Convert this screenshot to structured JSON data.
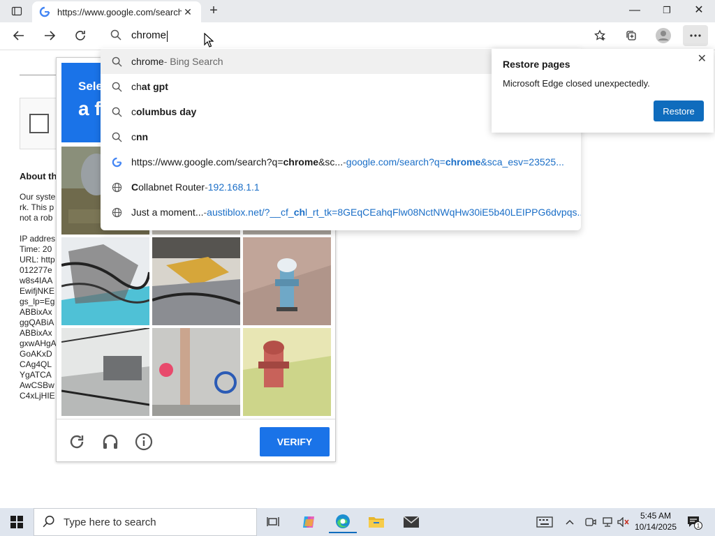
{
  "browser": {
    "tab": {
      "title": "https://www.google.com/search?"
    },
    "window_controls": {
      "minimize": "—",
      "maximize": "❐",
      "close": "✕"
    }
  },
  "omnibox": {
    "value": "chrome"
  },
  "suggestions": [
    {
      "icon": "search-icon",
      "bold": "",
      "rest": "chrome",
      "tail": " - Bing Search"
    },
    {
      "icon": "search-icon",
      "pre": "ch",
      "bold": "at gpt"
    },
    {
      "icon": "search-icon",
      "pre": "c",
      "bold": "olumbus day"
    },
    {
      "icon": "search-icon",
      "pre": "c",
      "bold": "nn"
    },
    {
      "icon": "google-icon",
      "url_pre": "https://www.google.com/search?q=",
      "url_bold": "chrome",
      "url_post": "&sc...",
      "link_pre": "google.com/search?q=",
      "link_bold": "chrome",
      "link_post": "&sca_esv=23525..."
    },
    {
      "icon": "globe-icon",
      "pre_bold": "C",
      "text": "ollabnet Router",
      "link": "192.168.1.1"
    },
    {
      "icon": "globe-icon",
      "text": "Just a moment...",
      "link_pre": "austiblox.net/?__cf_",
      "link_bold": "ch",
      "link_post": "l_rt_tk=8GEqCEahqFlw08NctNWqHw30iE5b40LEIPPG6dvpqs..."
    }
  ],
  "separator": " - ",
  "restore_popup": {
    "title": "Restore pages",
    "message": "Microsoft Edge closed unexpectedly.",
    "button": "Restore"
  },
  "page": {
    "about_heading": "About th",
    "about_lines": [
      "Our syste",
      "rk. This p",
      "not a rob",
      "",
      "IP addres",
      "Time: 20",
      "URL: http",
      "012277e",
      "w8s4IAA",
      "EwifjNKE",
      "gs_lp=Eg",
      "ABBixAx",
      "ggQABiA",
      "ABBixAx",
      "gxwAHgA",
      "GoAKxD",
      "CAg4QL",
      "YgATCA",
      "AwCSBw",
      "C4xLjHIE"
    ]
  },
  "captcha": {
    "header_line1": "Selec",
    "header_line2": "a f",
    "verify_label": "VERIFY"
  },
  "taskbar": {
    "search_placeholder": "Type here to search",
    "time": "5:45 AM",
    "date": "10/14/2025",
    "notification_count": "1"
  }
}
